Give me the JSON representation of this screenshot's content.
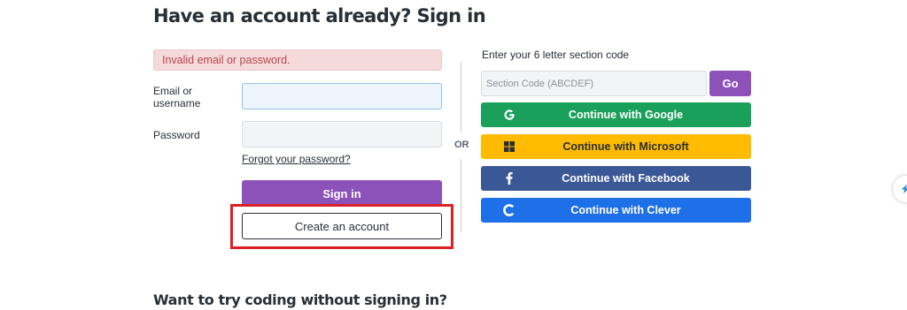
{
  "heading": "Have an account already? Sign in",
  "error_message": "Invalid email or password.",
  "form": {
    "email_label": "Email or username",
    "email_value": "",
    "password_label": "Password",
    "password_value": "",
    "forgot_link": "Forgot your password?",
    "signin_label": "Sign in",
    "create_account_label": "Create an account"
  },
  "divider_text": "OR",
  "section": {
    "label": "Enter your 6 letter section code",
    "placeholder": "Section Code (ABCDEF)",
    "go_label": "Go"
  },
  "sso": [
    {
      "label": "Continue with Google",
      "icon": "google-icon",
      "color": "#1aa05a"
    },
    {
      "label": "Continue with Microsoft",
      "icon": "microsoft-icon",
      "color": "#ffbb00"
    },
    {
      "label": "Continue with Facebook",
      "icon": "facebook-icon",
      "color": "#3b5896"
    },
    {
      "label": "Continue with Clever",
      "icon": "clever-icon",
      "color": "#1e70e8"
    }
  ],
  "footer_heading": "Want to try coding without signing in?",
  "colors": {
    "primary": "#8c52ba",
    "error_bg": "#f4dada",
    "error_text": "#b9464e",
    "highlight": "#dd1f26"
  }
}
